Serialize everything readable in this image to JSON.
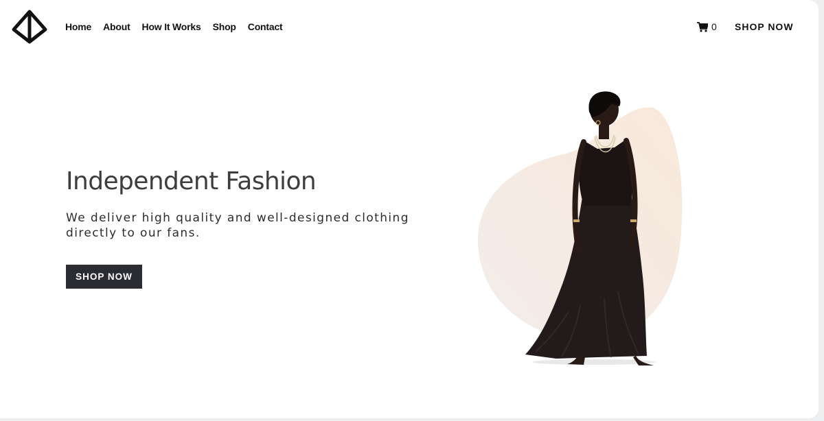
{
  "header": {
    "nav": [
      "Home",
      "About",
      "How It Works",
      "Shop",
      "Contact"
    ],
    "cart_count": "0",
    "shop_label": "SHOP NOW"
  },
  "hero": {
    "title": "Independent Fashion",
    "subtitle": "We deliver high quality and well-designed clothing directly to our fans.",
    "button_label": "SHOP NOW"
  },
  "colors": {
    "button_bg": "#2b2c31",
    "blob": "#f6ebe0",
    "text": "#3d3d3f"
  },
  "icons": {
    "logo": "diamond-logo-icon",
    "cart": "shopping-cart-icon"
  }
}
